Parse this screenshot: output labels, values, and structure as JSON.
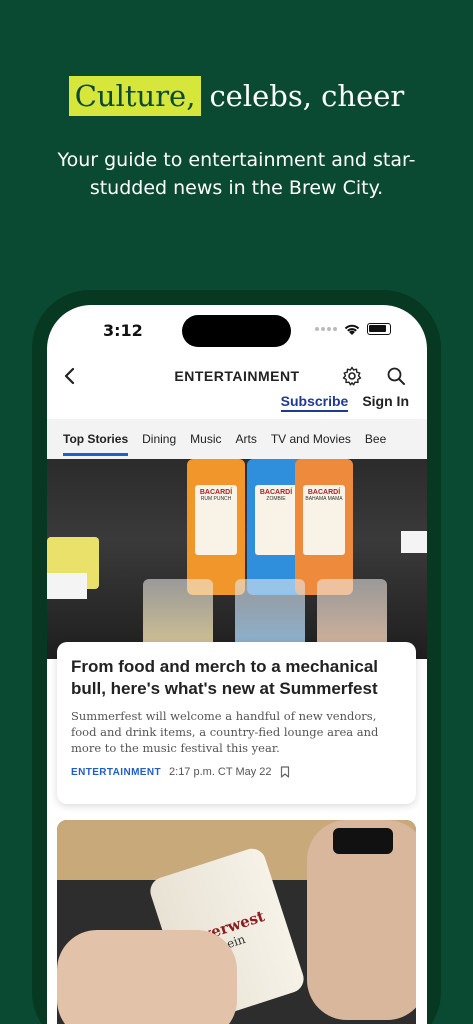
{
  "hero": {
    "highlight": "Culture,",
    "rest": "celebs, cheer",
    "subtitle": "Your guide to entertainment and star-studded news in the Brew City.",
    "colors": {
      "background": "#0a4a32",
      "highlight": "#d6e63a"
    }
  },
  "statusbar": {
    "time": "3:12"
  },
  "navbar": {
    "title": "ENTERTAINMENT"
  },
  "account": {
    "subscribe_label": "Subscribe",
    "signin_label": "Sign In"
  },
  "tabs": [
    "Top Stories",
    "Dining",
    "Music",
    "Arts",
    "TV and Movies",
    "Bee"
  ],
  "photo1": {
    "bottles": [
      {
        "brand": "BACARDÍ",
        "flavor": "RUM PUNCH"
      },
      {
        "brand": "BACARDÍ",
        "flavor": "ZOMBIE"
      },
      {
        "brand": "BACARDÍ",
        "flavor": "BAHAMA MAMA"
      }
    ]
  },
  "article1": {
    "title": "From food and merch to a mechanical bull, here's what's new at Summerfest",
    "summary": "Summerfest will welcome a handful of new vendors, food and drink items, a country-fied lounge area and more to the music festival this year.",
    "category": "ENTERTAINMENT",
    "time": "2:17 p.m. CT May 22"
  },
  "photo2": {
    "can_brand": "Riverwest",
    "can_flavor": "Stein"
  }
}
